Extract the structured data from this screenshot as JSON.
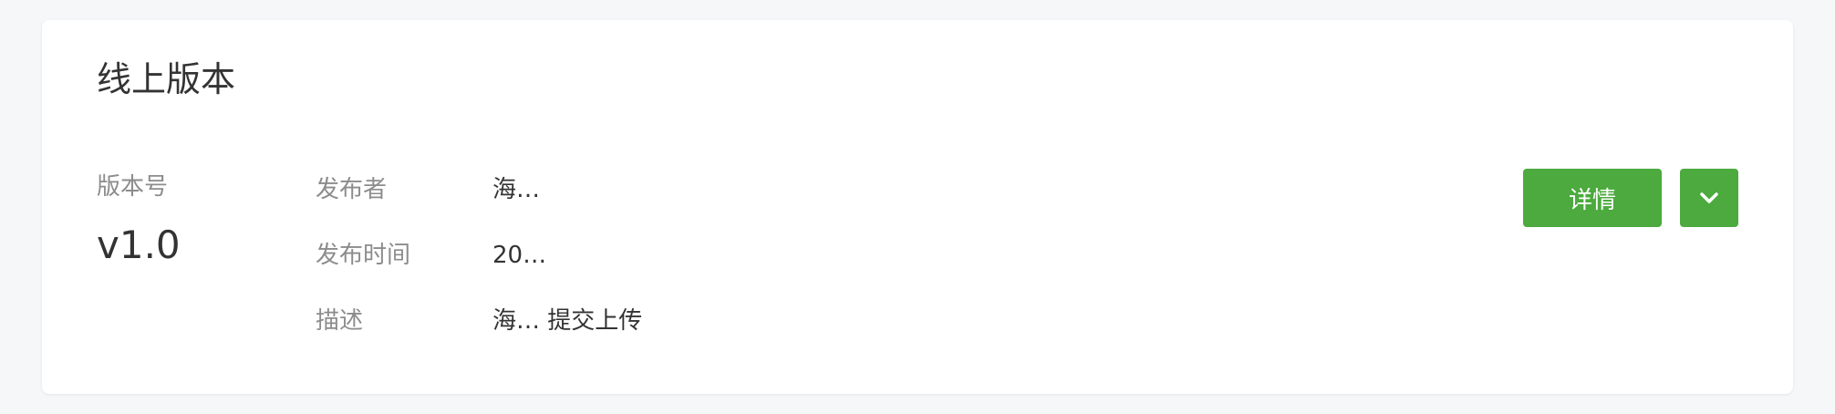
{
  "card": {
    "title": "线上版本"
  },
  "version": {
    "label": "版本号",
    "value": "v1.0"
  },
  "meta": {
    "publisher": {
      "label": "发布者",
      "value": "海…"
    },
    "publish_time": {
      "label": "发布时间",
      "value": "20…"
    },
    "description": {
      "label": "描述",
      "value": "海… 提交上传"
    }
  },
  "actions": {
    "detail_label": "详情",
    "more_icon": "chevron-down-icon"
  },
  "colors": {
    "accent": "#4caa3e",
    "label": "#8c8c8c",
    "text": "#333333",
    "background": "#f6f7f9"
  }
}
